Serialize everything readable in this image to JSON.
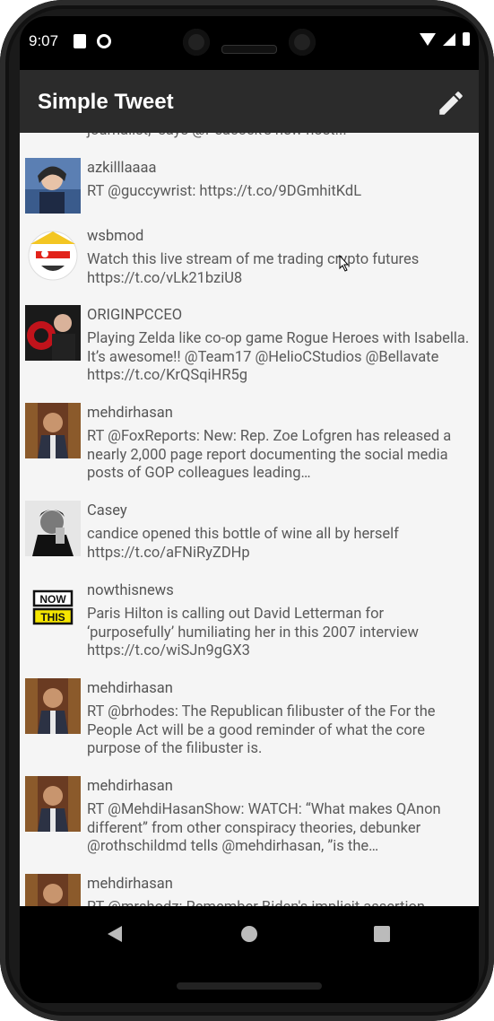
{
  "status": {
    "time": "9:07"
  },
  "app": {
    "title": "Simple Tweet",
    "compose_icon": "pencil-icon"
  },
  "tweets": [
    {
      "username": "",
      "text": "journalist,\" says @Peacock's new host..."
    },
    {
      "username": "azkilllaaaa",
      "text": "RT @guccywrist: https://t.co/9DGmhitKdL"
    },
    {
      "username": "wsbmod",
      "text": "Watch this live stream of me trading crypto futures https://t.co/vLk21bziU8"
    },
    {
      "username": "ORIGINPCCEO",
      "text": "Playing Zelda like co-op game Rogue Heroes with Isabella. It’s awesome!!  @Team17 @HelioCStudios @Bellavate https://t.co/KrQSqiHR5g"
    },
    {
      "username": "mehdirhasan",
      "text": "RT @FoxReports: New: Rep. Zoe Lofgren has released a nearly 2,000 page report documenting the social media posts of GOP colleagues leading…"
    },
    {
      "username": "Casey",
      "text": "candice opened this bottle of wine all by herself https://t.co/aFNiRyZDHp"
    },
    {
      "username": "nowthisnews",
      "text": "Paris Hilton is calling out David Letterman for ‘purposefully’ humiliating her in this 2007 interview https://t.co/wiSJn9gGX3"
    },
    {
      "username": "mehdirhasan",
      "text": "RT @brhodes: The Republican filibuster of the For the People Act will be a good reminder of what the core purpose of the filibuster is."
    },
    {
      "username": "mehdirhasan",
      "text": "RT @MehdiHasanShow: WATCH: “What makes QAnon different” from other conspiracy theories, debunker @rothschildmd tells @mehdirhasan, ”is the…"
    },
    {
      "username": "mehdirhasan",
      "text": "RT @mrshodz: Remember Biden's implicit assertion"
    }
  ],
  "nowthis_logo": {
    "line1": "NOW",
    "line2": "THIS"
  },
  "colors": {
    "appbar": "#2b2b2b",
    "list_bg": "#f5f5f5",
    "text": "#5a5a5a"
  }
}
